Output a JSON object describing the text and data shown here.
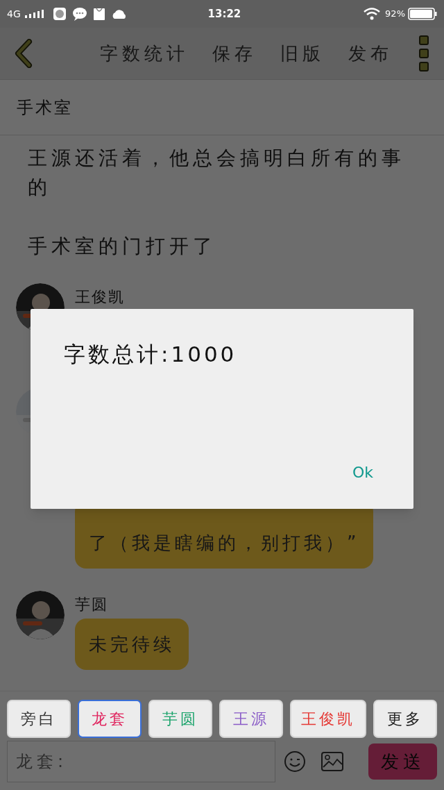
{
  "status_bar": {
    "network": "4G",
    "time": "13:22",
    "battery": "92%"
  },
  "toolbar": {
    "actions": [
      "字数统计",
      "保存",
      "旧版",
      "发布"
    ]
  },
  "title": "手术室",
  "story": [
    {
      "kind": "narration",
      "text": "王源还活着，他总会搞明白所有的事的"
    },
    {
      "kind": "narration",
      "text": "手术室的门打开了"
    },
    {
      "kind": "message",
      "speaker": "王俊凯"
    },
    {
      "kind": "message",
      "lines": [
        "了（我是瞎编的，别打我）”"
      ]
    },
    {
      "kind": "message",
      "speaker": "芋圆",
      "lines": [
        "未完待续"
      ]
    }
  ],
  "roles": [
    {
      "label": "旁白",
      "color": "#333333",
      "selected": false
    },
    {
      "label": "龙套",
      "color": "#e0245e",
      "selected": true
    },
    {
      "label": "芋圆",
      "color": "#1aa36b",
      "selected": false
    },
    {
      "label": "王源",
      "color": "#8a5cc7",
      "selected": false
    },
    {
      "label": "王俊凯",
      "color": "#e53935",
      "selected": false
    },
    {
      "label": "更多",
      "color": "#222222",
      "selected": false
    }
  ],
  "input": {
    "placeholder": "龙套:"
  },
  "send_button": "发送",
  "dialog": {
    "message": "字数总计:1000",
    "button": "Ok"
  }
}
